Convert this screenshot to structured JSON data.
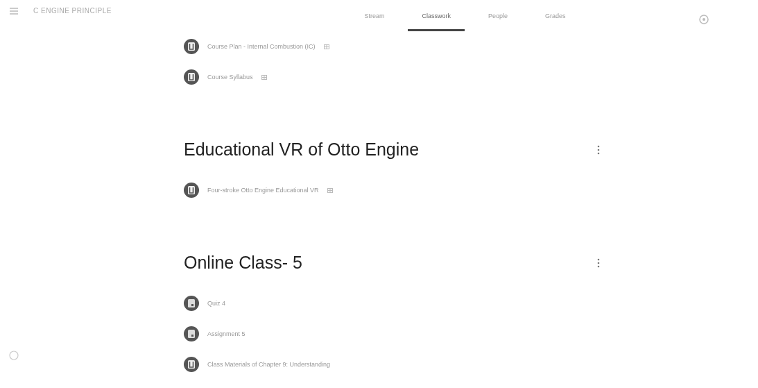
{
  "header": {
    "class_title": "C ENGINE PRINCIPLE"
  },
  "tabs": [
    {
      "label": "Stream",
      "selected": false
    },
    {
      "label": "Classwork",
      "selected": true
    },
    {
      "label": "People",
      "selected": false
    },
    {
      "label": "Grades",
      "selected": false
    }
  ],
  "topics": [
    {
      "items": [
        {
          "kind": "material",
          "title": "Course Plan - Internal Combustion (IC)",
          "attachment": true
        },
        {
          "kind": "material",
          "title": "Course Syllabus",
          "attachment": true
        }
      ]
    },
    {
      "title": "Educational VR of Otto Engine",
      "items": [
        {
          "kind": "material",
          "title": "Four-stroke Otto Engine Educational VR",
          "attachment": true
        }
      ]
    },
    {
      "title": "Online Class- 5",
      "items": [
        {
          "kind": "assignment",
          "title": "Quiz 4",
          "attachment": false
        },
        {
          "kind": "assignment",
          "title": "Assignment 5",
          "attachment": false
        },
        {
          "kind": "material",
          "title": "Class Materials of Chapter 9: Understanding",
          "attachment": false
        }
      ]
    }
  ]
}
